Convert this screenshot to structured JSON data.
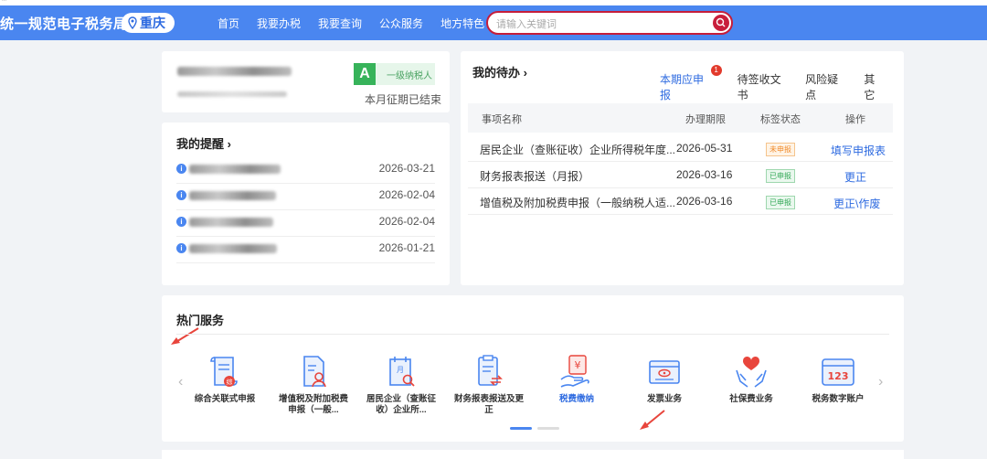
{
  "topstrip": {
    "text": "..."
  },
  "header": {
    "site_title": "统一规范电子税务局",
    "city": "重庆",
    "nav": [
      "首页",
      "我要办税",
      "我要查询",
      "公众服务",
      "地方特色"
    ],
    "search_placeholder": "请输入关键词"
  },
  "profile": {
    "grade_letter": "A",
    "taxpayer_type": "一级纳税人",
    "period_status": "本月征期已结束"
  },
  "reminders": {
    "title": "我的提醒 ›",
    "items": [
      {
        "date": "2026-03-21"
      },
      {
        "date": "2026-02-04"
      },
      {
        "date": "2026-02-04"
      },
      {
        "date": "2026-01-21"
      }
    ]
  },
  "todo": {
    "title": "我的待办 ›",
    "tabs": [
      {
        "label": "本期应申报",
        "badge": "1"
      },
      {
        "label": "待签收文书"
      },
      {
        "label": "风险疑点"
      },
      {
        "label": "其它"
      }
    ],
    "columns": [
      "事项名称",
      "办理期限",
      "标签状态",
      "操作"
    ],
    "rows": [
      {
        "name": "居民企业（查账征收）企业所得税年度...",
        "deadline": "2026-05-31",
        "status": "未申报",
        "action": "填写申报表"
      },
      {
        "name": "财务报表报送（月报）",
        "deadline": "2026-03-16",
        "status": "已申报",
        "action": "更正"
      },
      {
        "name": "增值税及附加税费申报（一般纳税人适...",
        "deadline": "2026-03-16",
        "status": "已申报",
        "action": "更正\\作废"
      }
    ]
  },
  "hot_services": {
    "title": "热门服务",
    "items": [
      {
        "label": "综合关联式申报",
        "icon": "composite-declaration-icon"
      },
      {
        "label": "增值税及附加税费申报（一般...",
        "icon": "vat-declaration-icon"
      },
      {
        "label": "居民企业（查账征收）企业所...",
        "icon": "calendar-search-icon"
      },
      {
        "label": "财务报表报送及更正",
        "icon": "report-exchange-icon"
      },
      {
        "label": "税费缴纳",
        "icon": "tax-payment-icon"
      },
      {
        "label": "发票业务",
        "icon": "invoice-icon"
      },
      {
        "label": "社保费业务",
        "icon": "social-security-icon"
      },
      {
        "label": "税务数字账户",
        "icon": "digital-account-icon"
      }
    ],
    "prev": "‹",
    "next": "›",
    "active_page": 1,
    "page_count": 2
  },
  "colors": {
    "header_bg": "#4a86f0",
    "accent": "#2d6ae0",
    "search_border": "#c61d3a",
    "grade": "#37b35a"
  }
}
